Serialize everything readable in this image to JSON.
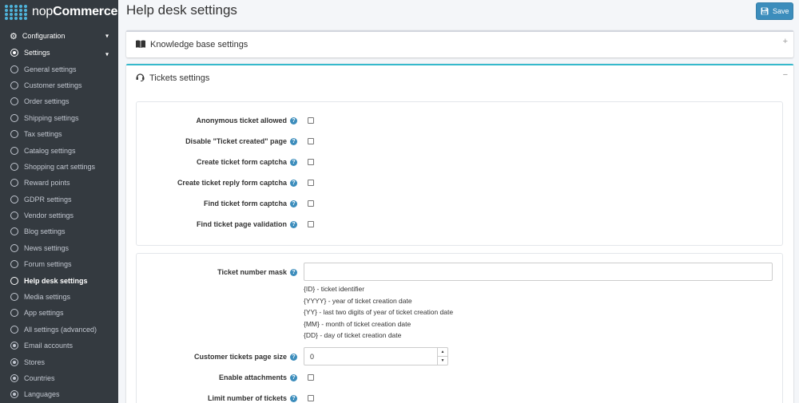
{
  "brand": {
    "part1": "nop",
    "part2": "Commerce"
  },
  "sidebar": {
    "configuration": "Configuration",
    "settings": "Settings",
    "items": [
      {
        "label": "General settings"
      },
      {
        "label": "Customer settings"
      },
      {
        "label": "Order settings"
      },
      {
        "label": "Shipping settings"
      },
      {
        "label": "Tax settings"
      },
      {
        "label": "Catalog settings"
      },
      {
        "label": "Shopping cart settings"
      },
      {
        "label": "Reward points"
      },
      {
        "label": "GDPR settings"
      },
      {
        "label": "Vendor settings"
      },
      {
        "label": "Blog settings"
      },
      {
        "label": "News settings"
      },
      {
        "label": "Forum settings"
      },
      {
        "label": "Help desk settings"
      },
      {
        "label": "Media settings"
      },
      {
        "label": "App settings"
      },
      {
        "label": "All settings (advanced)"
      }
    ],
    "after_items": [
      {
        "label": "Email accounts"
      },
      {
        "label": "Stores"
      },
      {
        "label": "Countries"
      },
      {
        "label": "Languages"
      }
    ]
  },
  "header": {
    "title": "Help desk settings",
    "save": "Save"
  },
  "kb_panel": {
    "title": "Knowledge base settings",
    "toggle": "+"
  },
  "tickets_panel": {
    "title": "Tickets settings",
    "toggle": "−",
    "checkboxes": [
      {
        "label": "Anonymous ticket allowed",
        "checked": false
      },
      {
        "label": "Disable \"Ticket created\" page",
        "checked": false
      },
      {
        "label": "Create ticket form captcha",
        "checked": false
      },
      {
        "label": "Create ticket reply form captcha",
        "checked": false
      },
      {
        "label": "Find ticket form captcha",
        "checked": false
      },
      {
        "label": "Find ticket page validation",
        "checked": false
      }
    ],
    "mask": {
      "label": "Ticket number mask",
      "value": "",
      "hints": [
        "{ID} - ticket identifier",
        "{YYYY} - year of ticket creation date",
        "{YY} - last two digits of year of ticket creation date",
        "{MM} - month of ticket creation date",
        "{DD} - day of ticket creation date"
      ]
    },
    "page_size": {
      "label": "Customer tickets page size",
      "value": "0"
    },
    "enable_attachments": {
      "label": "Enable attachments",
      "checked": false
    },
    "limit_tickets": {
      "label": "Limit number of tickets",
      "checked": false
    }
  },
  "icons": {
    "help": "?",
    "save": "floppy-icon",
    "book": "book-icon",
    "headset": "headset-icon",
    "gears": "gears-icon"
  },
  "colors": {
    "accent": "#3c8dbc",
    "teal": "#36b9cc",
    "sidebar": "#343a40"
  }
}
